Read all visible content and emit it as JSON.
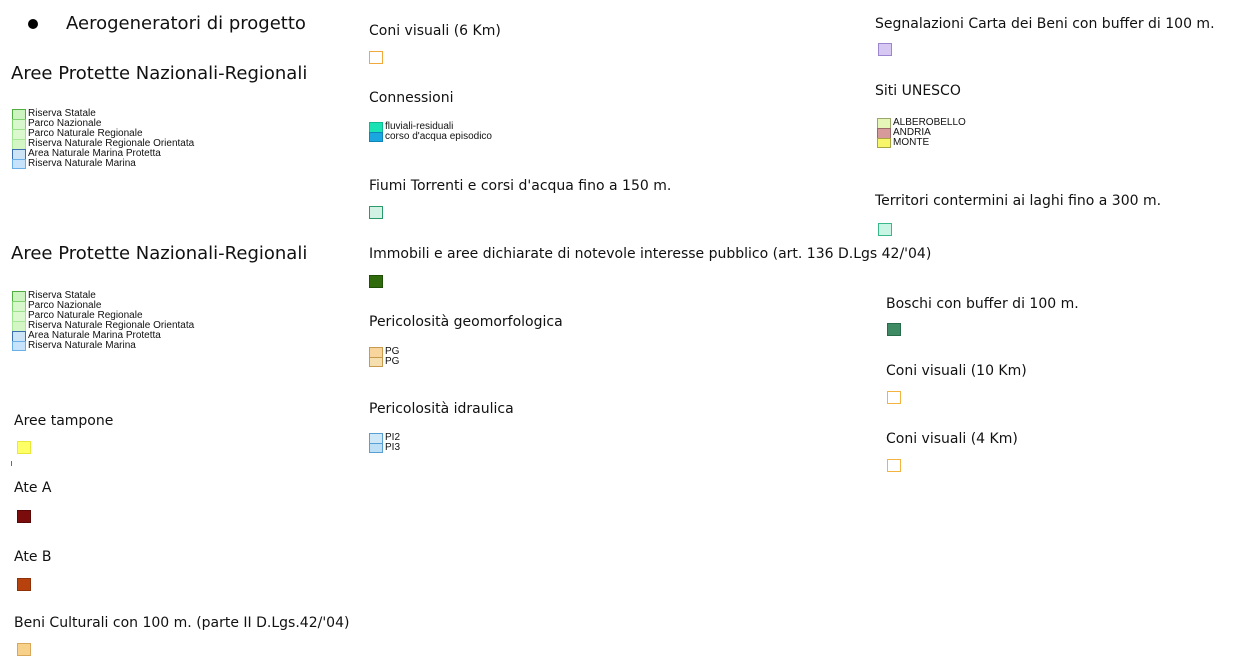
{
  "legend": {
    "aerogeneratori": "Aerogeneratori di progetto",
    "aree_protette_1": {
      "title": "Aree Protette Nazionali-Regionali",
      "items": [
        {
          "label": "Riserva Statale",
          "fill": "#cdf4c0",
          "stroke": "#4fae3f"
        },
        {
          "label": "Parco Nazionale",
          "fill": "#d9f7cc",
          "stroke": "#7ed36e"
        },
        {
          "label": "Parco Naturale Regionale",
          "fill": "#dcf8cf",
          "stroke": "#9be28c"
        },
        {
          "label": "Riserva Naturale Regionale Orientata",
          "fill": "#d3f6c4",
          "stroke": "#a7e898"
        },
        {
          "label": "Area Naturale Marina Protetta",
          "fill": "#cde4f7",
          "stroke": "#3b6fb0"
        },
        {
          "label": "Riserva Naturale Marina",
          "fill": "#c7e2fb",
          "stroke": "#6aaee8"
        }
      ]
    },
    "aree_protette_2": {
      "title": "Aree Protette Nazionali-Regionali",
      "items": [
        {
          "label": "Riserva Statale",
          "fill": "#cdf4c0",
          "stroke": "#4fae3f"
        },
        {
          "label": "Parco Nazionale",
          "fill": "#d9f7cc",
          "stroke": "#7ed36e"
        },
        {
          "label": "Parco Naturale Regionale",
          "fill": "#dcf8cf",
          "stroke": "#9be28c"
        },
        {
          "label": "Riserva Naturale Regionale Orientata",
          "fill": "#d3f6c4",
          "stroke": "#a7e898"
        },
        {
          "label": "Area Naturale Marina Protetta",
          "fill": "#cde4f7",
          "stroke": "#3b6fb0"
        },
        {
          "label": "Riserva Naturale Marina",
          "fill": "#c7e2fb",
          "stroke": "#6aaee8"
        }
      ]
    },
    "aree_tampone": {
      "title": "Aree tampone",
      "fill": "#ffff66",
      "stroke": "#e8e83a"
    },
    "ate_a": {
      "title": "Ate A",
      "fill": "#7a0c0c",
      "stroke": "#5a0707"
    },
    "ate_b": {
      "title": "Ate B",
      "fill": "#b8420e",
      "stroke": "#8e3008"
    },
    "beni_culturali": {
      "title": "Beni Culturali con 100 m. (parte II  D.Lgs.42/'04)",
      "fill": "#f7d08a",
      "stroke": "#d8a75a"
    },
    "coni_6km": {
      "title": "Coni visuali (6 Km)",
      "fill": "#ffffff",
      "stroke": "#f2a93b"
    },
    "connessioni": {
      "title": "Connessioni",
      "items": [
        {
          "label": "fluviali-residuali",
          "fill": "#19e3b5",
          "stroke": "#0fb88f"
        },
        {
          "label": "corso d'acqua episodico",
          "fill": "#1aa7e0",
          "stroke": "#0f84b8"
        }
      ]
    },
    "fiumi": {
      "title": "Fiumi Torrenti e corsi d'acqua fino a 150 m.",
      "fill": "#d2f2e6",
      "stroke": "#2a9a6a"
    },
    "immobili": {
      "title": "Immobili e aree dichiarate di notevole interesse pubblico (art. 136 D.Lgs 42/'04)",
      "fill": "#2f6b0d",
      "stroke": "#1f4f07"
    },
    "pericolosita_geo": {
      "title": "Pericolosità geomorfologica",
      "items": [
        {
          "label": "PG",
          "fill": "#f7d59c",
          "stroke": "#c89a4e"
        },
        {
          "label": "PG",
          "fill": "#f5dfae",
          "stroke": "#c89a4e"
        }
      ]
    },
    "pericolosita_idr": {
      "title": "Pericolosità idraulica",
      "items": [
        {
          "label": "PI2",
          "fill": "#cfe8f8",
          "stroke": "#5a9fd2"
        },
        {
          "label": "PI3",
          "fill": "#bde0f6",
          "stroke": "#5a9fd2"
        }
      ]
    },
    "segnalazioni": {
      "title": "Segnalazioni Carta dei Beni con buffer di 100 m.",
      "fill": "#d6c8f2",
      "stroke": "#9b86cf"
    },
    "siti_unesco": {
      "title": "Siti UNESCO",
      "items": [
        {
          "label": "ALBEROBELLO",
          "fill": "#e6f5b8",
          "stroke": "#9aa86a"
        },
        {
          "label": "ANDRIA",
          "fill": "#d69a9a",
          "stroke": "#9a6a6a"
        },
        {
          "label": "MONTE",
          "fill": "#f7f56a",
          "stroke": "#a8a640"
        }
      ]
    },
    "territori_laghi": {
      "title": "Territori contermini ai laghi fino a 300 m.",
      "fill": "#c8f5e4",
      "stroke": "#3ab88a"
    },
    "boschi": {
      "title": "Boschi con buffer di 100 m.",
      "fill": "#3d8a63",
      "stroke": "#286b4a"
    },
    "coni_10km": {
      "title": "Coni visuali (10 Km)",
      "fill": "#ffffff",
      "stroke": "#f2b340"
    },
    "coni_4km": {
      "title": "Coni visuali (4 Km)",
      "fill": "#ffffff",
      "stroke": "#f2b340"
    }
  }
}
